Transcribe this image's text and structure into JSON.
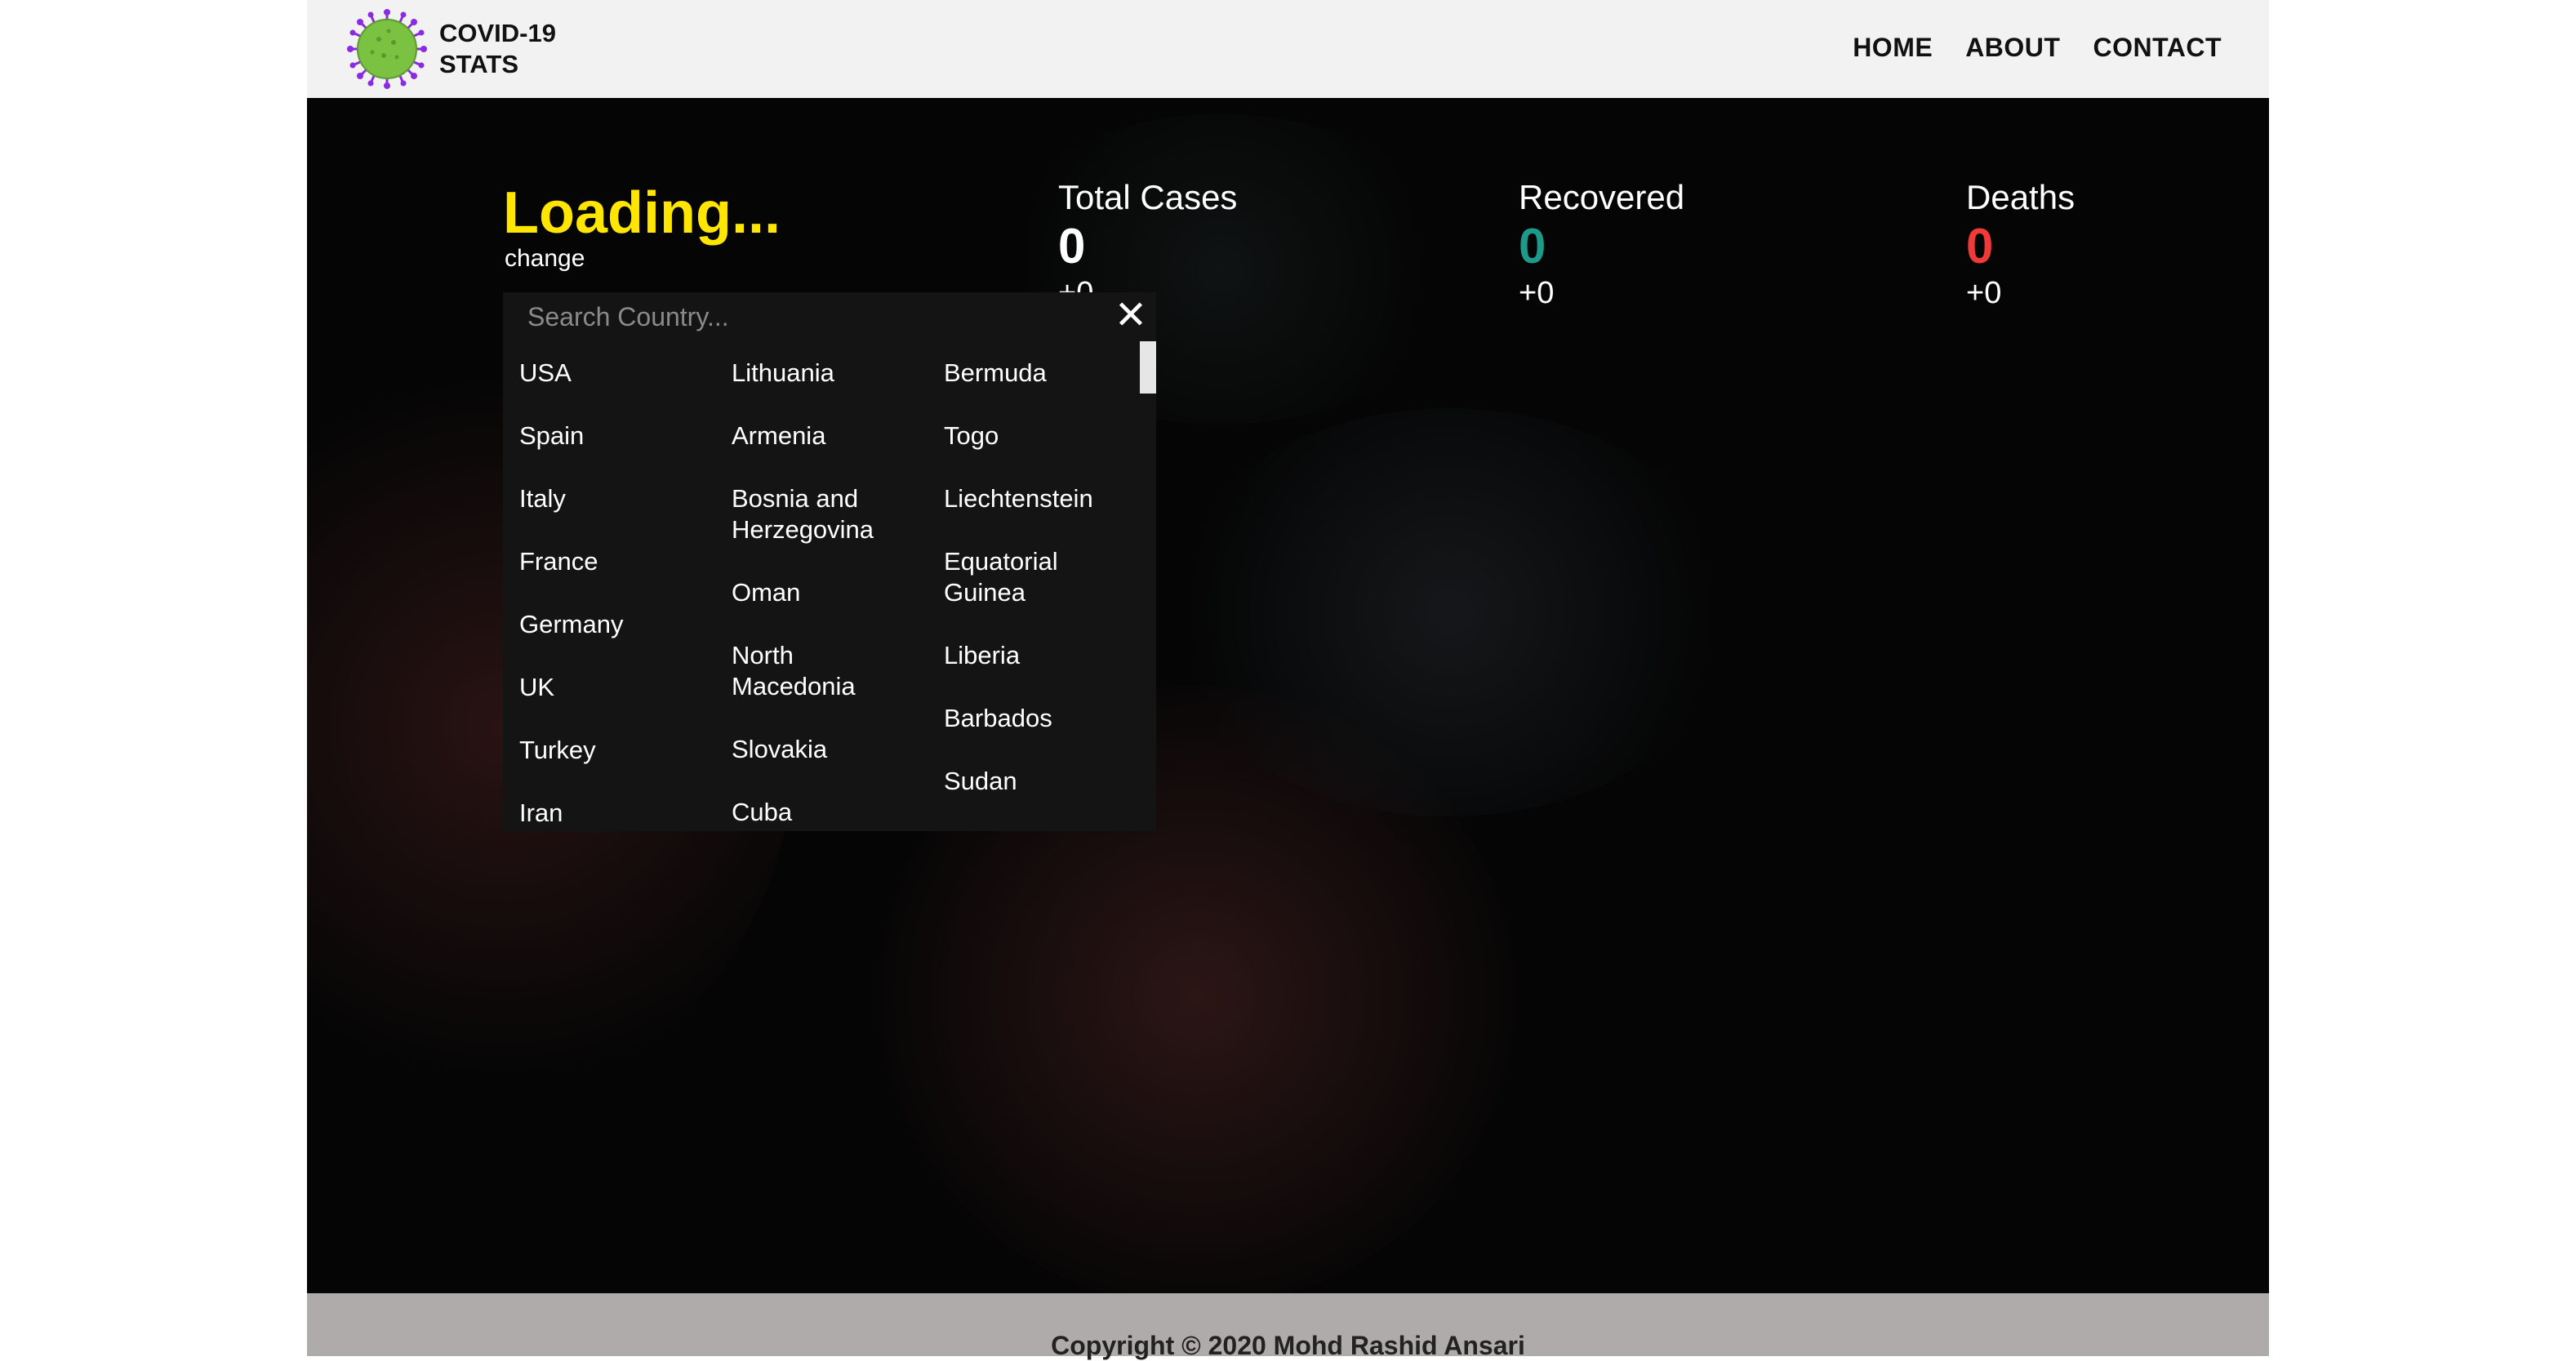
{
  "header": {
    "brand_line1": "COVID-19",
    "brand_line2": "STATS",
    "logo_icon": "virus-icon",
    "nav": [
      "HOME",
      "ABOUT",
      "CONTACT"
    ]
  },
  "hero": {
    "loading_text": "Loading...",
    "change_link": "change",
    "stats": {
      "total": {
        "label": "Total Cases",
        "value": "0",
        "delta": "+0"
      },
      "recovered": {
        "label": "Recovered",
        "value": "0",
        "delta": "+0"
      },
      "deaths": {
        "label": "Deaths",
        "value": "0",
        "delta": "+0"
      }
    }
  },
  "dropdown": {
    "search_placeholder": "Search Country...",
    "close_icon": "close-icon",
    "columns": [
      [
        "USA",
        "Spain",
        "Italy",
        "France",
        "Germany",
        "UK",
        "Turkey",
        "Iran"
      ],
      [
        "Lithuania",
        "Armenia",
        "Bosnia and Herzegovina",
        "Oman",
        "North Macedonia",
        "Slovakia",
        "Cuba"
      ],
      [
        "Bermuda",
        "Togo",
        "Liechtenstein",
        "Equatorial Guinea",
        "Liberia",
        "Barbados",
        "Sudan"
      ]
    ]
  },
  "footer": {
    "copyright": "Copyright © 2020 Mohd Rashid Ansari"
  },
  "colors": {
    "header_bg": "#f2f2f2",
    "hero_bg": "#050505",
    "loading": "#ffe600",
    "recovered": "#1e9a8a",
    "deaths": "#f03a3a",
    "footer_bg": "#b0abab"
  }
}
